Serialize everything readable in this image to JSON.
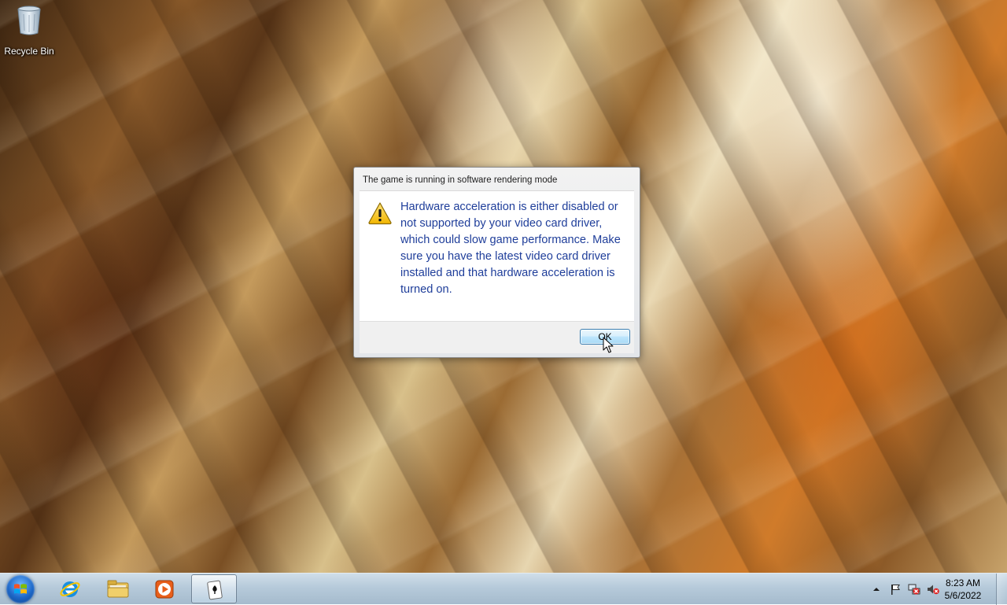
{
  "desktop": {
    "icons": [
      {
        "label": "Recycle Bin",
        "icon": "recycle-bin-icon"
      }
    ]
  },
  "dialog": {
    "title": "The game is running in software rendering mode",
    "icon": "warning-icon",
    "message": "Hardware acceleration is either disabled or not supported by your video card driver, which could slow game performance. Make sure you have the latest video card driver installed and that hardware acceleration is turned on.",
    "ok_label": "OK"
  },
  "taskbar": {
    "start": {
      "icon": "windows-start-icon"
    },
    "pinned": [
      {
        "icon": "internet-explorer-icon"
      },
      {
        "icon": "file-explorer-icon"
      },
      {
        "icon": "media-player-icon"
      },
      {
        "icon": "solitaire-icon",
        "active": true
      }
    ],
    "tray": {
      "icons": [
        "show-hidden-icons-arrow",
        "action-center-flag-icon",
        "network-icon",
        "volume-muted-icon"
      ],
      "time": "8:23 AM",
      "date": "5/6/2022"
    }
  }
}
